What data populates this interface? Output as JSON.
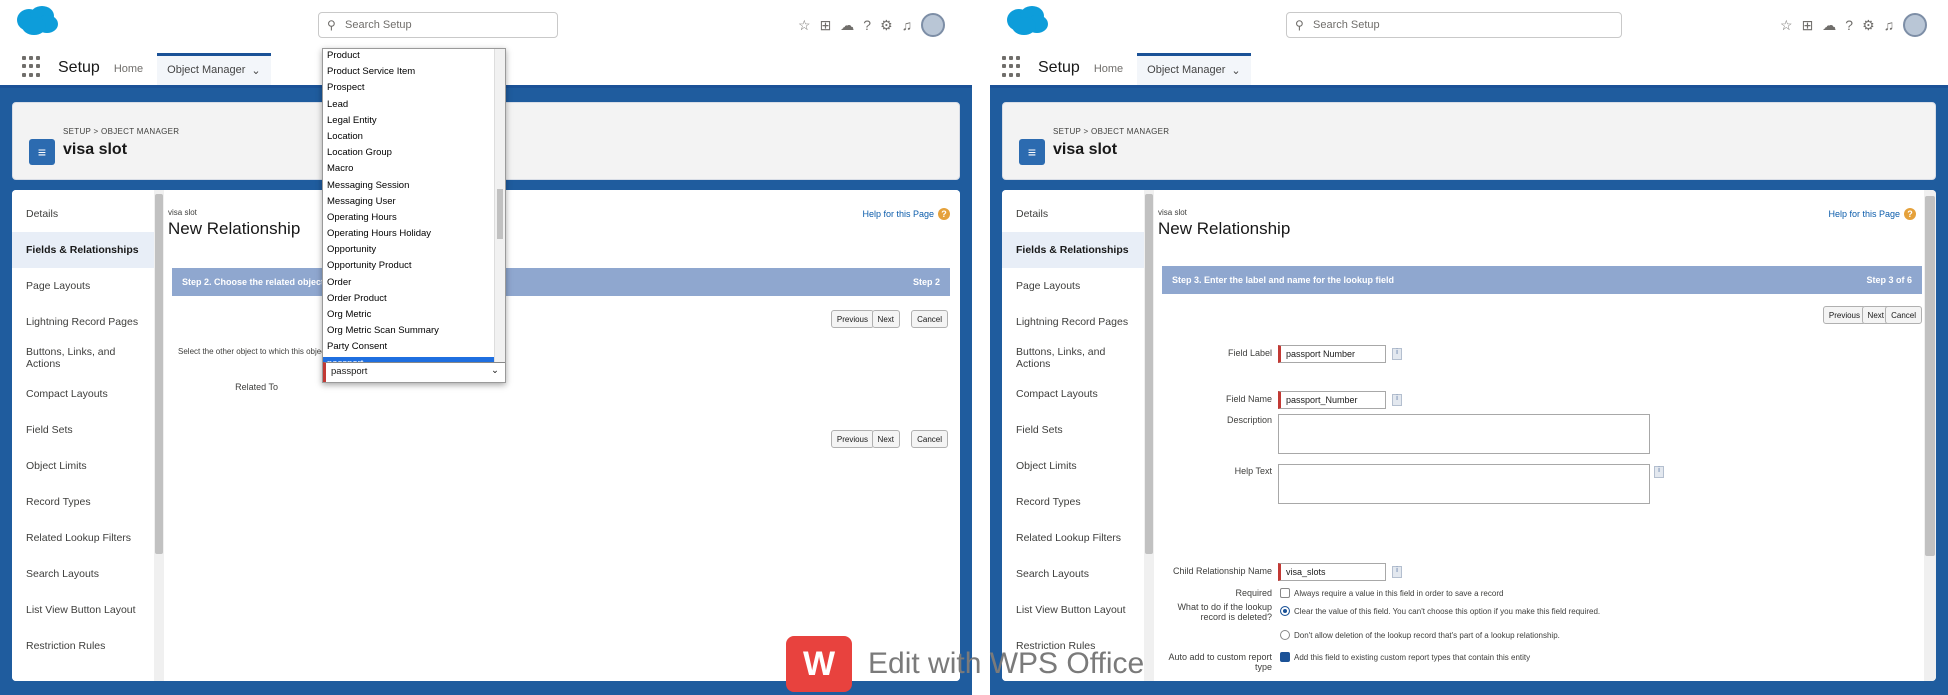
{
  "brand": {
    "primary": "#1f5c9e",
    "accent": "#0d9dda",
    "required": "#c23934",
    "help": "#e5a13b",
    "watermark": "#e8423e"
  },
  "left": {
    "search_placeholder": "Search Setup",
    "app_name": "Setup",
    "nav_link": "Home",
    "nav_tab": "Object Manager",
    "breadcrumb": "SETUP > OBJECT MANAGER",
    "object_title": "visa slot",
    "sidebar": [
      "Details",
      "Fields & Relationships",
      "Page Layouts",
      "Lightning Record Pages",
      "Buttons, Links, and Actions",
      "Compact Layouts",
      "Field Sets",
      "Object Limits",
      "Record Types",
      "Related Lookup Filters",
      "Search Layouts",
      "List View Button Layout",
      "Restriction Rules"
    ],
    "page_small": "visa slot",
    "page_title": "New Relationship",
    "help_link": "Help for this Page",
    "step_text": "Step 2. Choose the related object",
    "step_right": "Step 2",
    "btn_previous": "Previous",
    "btn_next": "Next",
    "btn_cancel": "Cancel",
    "instruction": "Select the other object to which this object is related.",
    "related_label": "Related To",
    "related_value": "passport",
    "dropdown": [
      "Product",
      "Product Service Item",
      "Prospect",
      "Lead",
      "Legal Entity",
      "Location",
      "Location Group",
      "Macro",
      "Messaging Session",
      "Messaging User",
      "Operating Hours",
      "Operating Hours Holiday",
      "Opportunity",
      "Opportunity Product",
      "Order",
      "Order Product",
      "Org Metric",
      "Org Metric Scan Summary",
      "Party Consent",
      "passport"
    ]
  },
  "right": {
    "search_placeholder": "Search Setup",
    "app_name": "Setup",
    "nav_link": "Home",
    "nav_tab": "Object Manager",
    "breadcrumb": "SETUP > OBJECT MANAGER",
    "object_title": "visa slot",
    "sidebar": [
      "Details",
      "Fields & Relationships",
      "Page Layouts",
      "Lightning Record Pages",
      "Buttons, Links, and Actions",
      "Compact Layouts",
      "Field Sets",
      "Object Limits",
      "Record Types",
      "Related Lookup Filters",
      "Search Layouts",
      "List View Button Layout",
      "Restriction Rules"
    ],
    "page_small": "visa slot",
    "page_title": "New Relationship",
    "help_link": "Help for this Page",
    "step_text": "Step 3. Enter the label and name for the lookup field",
    "step_right": "Step 3 of 6",
    "btn_previous": "Previous",
    "btn_next": "Next",
    "btn_cancel": "Cancel",
    "field_label_label": "Field Label",
    "field_label_value": "passport Number",
    "field_name_label": "Field Name",
    "field_name_value": "passport_Number",
    "description_label": "Description",
    "helptext_label": "Help Text",
    "child_rel_label": "Child Relationship Name",
    "child_rel_value": "visa_slots",
    "required_label": "Required",
    "required_text": "Always require a value in this field in order to save a record",
    "delete_label": "What to do if the lookup record is deleted?",
    "delete_opt1": "Clear the value of this field. You can't choose this option if you make this field required.",
    "delete_opt2": "Don't allow deletion of the lookup record that's part of a lookup relationship.",
    "filter_label": "Auto add to custom report type",
    "filter_text": "Add this field to existing custom report types that contain this entity"
  },
  "watermark": "Edit with WPS Office"
}
